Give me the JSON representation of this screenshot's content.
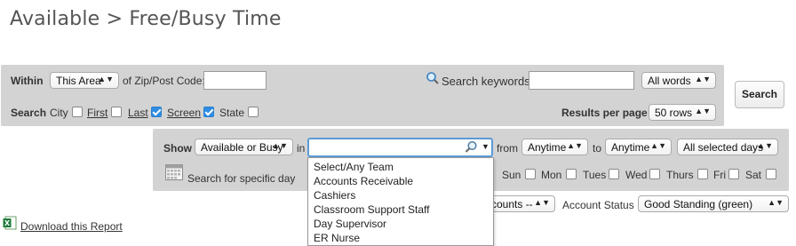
{
  "page": {
    "title": "Available > Free/Busy Time"
  },
  "row1": {
    "within_label": "Within",
    "within_value": "This Area",
    "zip_label": "of Zip/Post Code:",
    "zip_value": "",
    "search_keywords_label": "Search keywords",
    "keywords_value": "",
    "match_value": "All words"
  },
  "row2": {
    "search_label": "Search",
    "city_label": "City",
    "first_label": "First",
    "last_label": "Last",
    "screen_label": "Screen",
    "state_label": "State",
    "results_label": "Results per page",
    "results_value": "50 rows"
  },
  "search_button": "Search",
  "show_row": {
    "show_label": "Show",
    "show_value": "Available or Busy",
    "in_label": "in",
    "team_value": "",
    "from_label": "from",
    "from_value": "Anytime",
    "to_label": "to",
    "to_value": "Anytime",
    "days_value": "All selected days"
  },
  "specific_day_label": "Search for specific day",
  "days": {
    "sun": "Sun",
    "mon": "Mon",
    "tues": "Tues",
    "wed": "Wed",
    "thurs": "Thurs",
    "fri": "Fri",
    "sat": "Sat"
  },
  "team_dropdown": [
    "Select/Any Team",
    "Accounts Receivable",
    "Cashiers",
    "Classroom Support Staff",
    "Day Supervisor",
    "ER Nurse"
  ],
  "account": {
    "accounts_value": "ccounts --",
    "status_label": "Account Status",
    "status_value": "Good Standing (green)"
  },
  "download_label": "Download this Report",
  "checkbox_states": {
    "city": false,
    "first": false,
    "last": true,
    "screen": true,
    "state": false
  }
}
